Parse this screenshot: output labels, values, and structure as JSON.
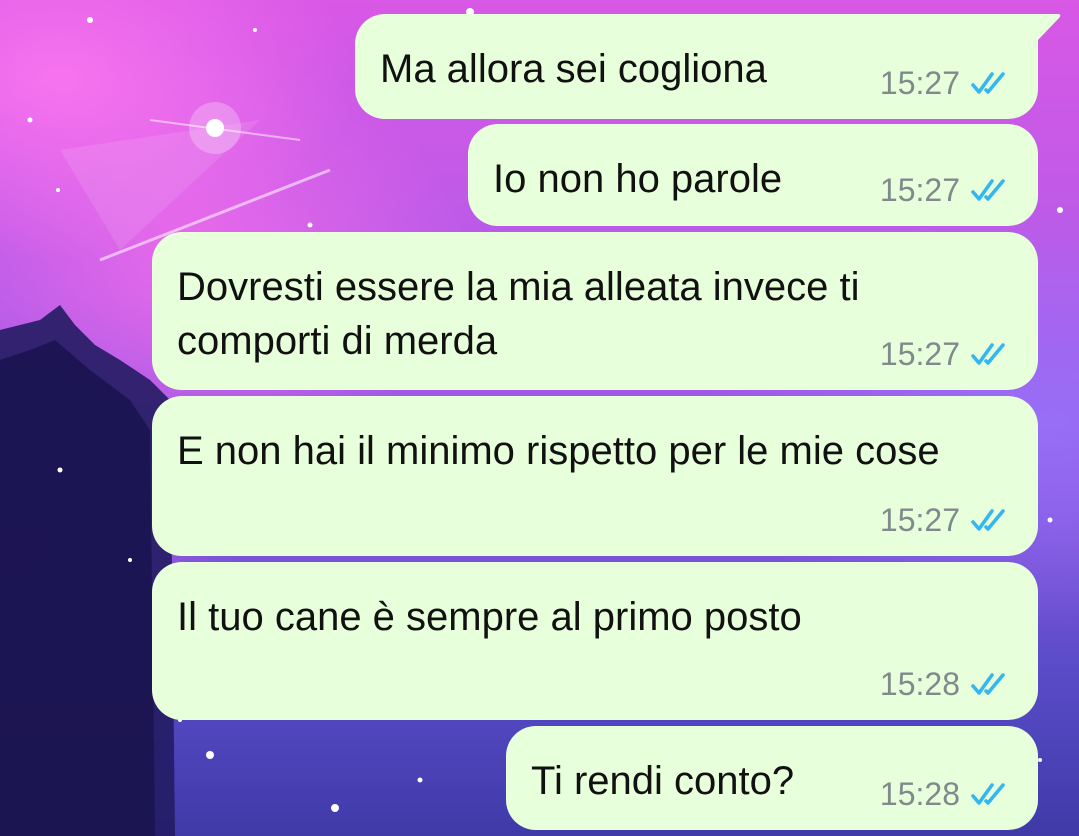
{
  "chat": {
    "messages": [
      {
        "text": "Ma allora sei cogliona",
        "time": "15:27",
        "status_icon": "double-check-read-icon"
      },
      {
        "text": "Io non ho parole",
        "time": "15:27",
        "status_icon": "double-check-read-icon"
      },
      {
        "text": "Dovresti essere la mia alleata invece ti comporti di merda",
        "time": "15:27",
        "status_icon": "double-check-read-icon"
      },
      {
        "text": "E non hai il minimo rispetto per le mie cose",
        "time": "15:27",
        "status_icon": "double-check-read-icon"
      },
      {
        "text": "Il tuo cane è sempre al primo posto",
        "time": "15:28",
        "status_icon": "double-check-read-icon"
      },
      {
        "text": "Ti rendi conto?",
        "time": "15:28",
        "status_icon": "double-check-read-icon"
      }
    ]
  },
  "colors": {
    "bubble": "#e7ffdb",
    "read_ticks": "#34b7f1",
    "time": "#808a8d"
  }
}
